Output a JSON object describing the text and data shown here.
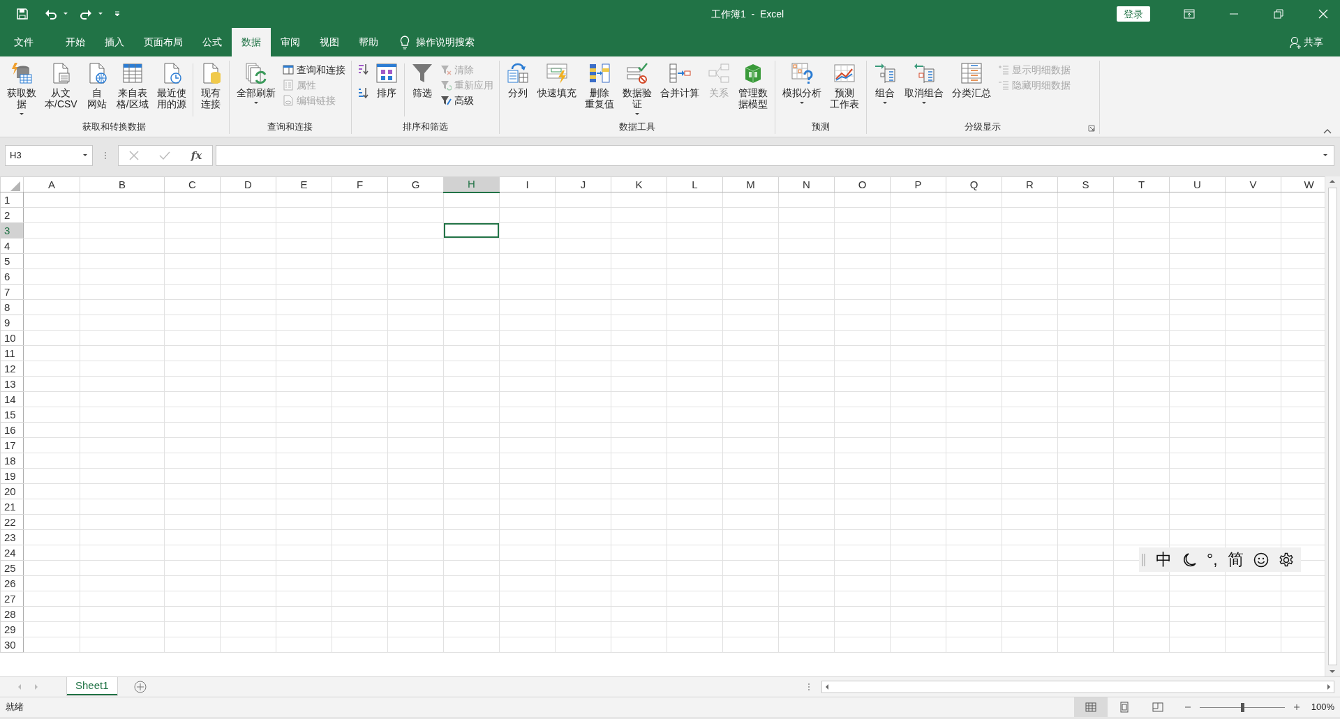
{
  "window": {
    "title": "工作簿1  -  Excel",
    "sign_in": "登录"
  },
  "tabs": [
    {
      "label": "文件",
      "selected": false
    },
    {
      "label": "开始",
      "selected": false
    },
    {
      "label": "插入",
      "selected": false
    },
    {
      "label": "页面布局",
      "selected": false
    },
    {
      "label": "公式",
      "selected": false
    },
    {
      "label": "数据",
      "selected": true
    },
    {
      "label": "审阅",
      "selected": false
    },
    {
      "label": "视图",
      "selected": false
    },
    {
      "label": "帮助",
      "selected": false
    }
  ],
  "tell_me": "操作说明搜索",
  "share": "共享",
  "ribbon": {
    "groups": [
      {
        "label": "获取和转换数据",
        "items": [
          {
            "kind": "large",
            "lines": [
              "获取数",
              "据"
            ],
            "dropdown": true,
            "disabled": false
          },
          {
            "kind": "large",
            "lines": [
              "从文",
              "本/CSV"
            ],
            "disabled": false
          },
          {
            "kind": "large",
            "lines": [
              "自",
              "网站"
            ],
            "disabled": false
          },
          {
            "kind": "large",
            "lines": [
              "来自表",
              "格/区域"
            ],
            "disabled": false
          },
          {
            "kind": "large",
            "lines": [
              "最近使",
              "用的源"
            ],
            "disabled": false
          },
          {
            "kind": "separator"
          },
          {
            "kind": "large",
            "lines": [
              "现有",
              "连接"
            ],
            "disabled": false
          }
        ]
      },
      {
        "label": "查询和连接",
        "items": [
          {
            "kind": "large",
            "lines": [
              "全部刷新"
            ],
            "dropdown": true,
            "disabled": false
          },
          {
            "kind": "stack",
            "items": [
              {
                "label": "查询和连接",
                "disabled": false
              },
              {
                "label": "属性",
                "disabled": true
              },
              {
                "label": "编辑链接",
                "disabled": true
              }
            ]
          }
        ]
      },
      {
        "label": "排序和筛选",
        "items": [
          {
            "kind": "stack",
            "items": [
              {
                "disabled": false
              },
              {
                "disabled": false
              }
            ]
          },
          {
            "kind": "large",
            "lines": [
              "排序"
            ],
            "disabled": false
          },
          {
            "kind": "separator"
          },
          {
            "kind": "large",
            "lines": [
              "筛选"
            ],
            "disabled": false
          },
          {
            "kind": "stack",
            "items": [
              {
                "label": "清除",
                "disabled": true
              },
              {
                "label": "重新应用",
                "disabled": true
              },
              {
                "label": "高级",
                "disabled": false
              }
            ]
          }
        ]
      },
      {
        "label": "数据工具",
        "items": [
          {
            "kind": "large",
            "lines": [
              "分列"
            ],
            "disabled": false
          },
          {
            "kind": "large",
            "lines": [
              "快速填充"
            ],
            "disabled": false
          },
          {
            "kind": "large",
            "lines": [
              "删除",
              "重复值"
            ],
            "disabled": false
          },
          {
            "kind": "large",
            "lines": [
              "数据验",
              "证"
            ],
            "dropdown": true,
            "disabled": false
          },
          {
            "kind": "large",
            "lines": [
              "合并计算"
            ],
            "disabled": false
          },
          {
            "kind": "large",
            "lines": [
              "关系"
            ],
            "disabled": true
          },
          {
            "kind": "large",
            "lines": [
              "管理数",
              "据模型"
            ],
            "disabled": false
          }
        ]
      },
      {
        "label": "预测",
        "items": [
          {
            "kind": "large",
            "lines": [
              "模拟分析"
            ],
            "dropdown": true,
            "disabled": false
          },
          {
            "kind": "large",
            "lines": [
              "预测",
              "工作表"
            ],
            "disabled": false
          }
        ]
      },
      {
        "label": "分级显示",
        "dialog_launcher": true,
        "items": [
          {
            "kind": "large",
            "lines": [
              "组合"
            ],
            "dropdown": true,
            "disabled": false
          },
          {
            "kind": "large",
            "lines": [
              "取消组合"
            ],
            "dropdown": true,
            "disabled": false
          },
          {
            "kind": "large",
            "lines": [
              "分类汇总"
            ],
            "disabled": false
          },
          {
            "kind": "stack",
            "items": [
              {
                "label": "显示明细数据",
                "disabled": true
              },
              {
                "label": "隐藏明细数据",
                "disabled": true
              }
            ]
          }
        ]
      }
    ]
  },
  "formula_bar": {
    "name_box": "H3",
    "function_label": "fx"
  },
  "columns": [
    {
      "label": "A",
      "selected": false
    },
    {
      "label": "B",
      "selected": false
    },
    {
      "label": "C",
      "selected": false
    },
    {
      "label": "D",
      "selected": false
    },
    {
      "label": "E",
      "selected": false
    },
    {
      "label": "F",
      "selected": false
    },
    {
      "label": "G",
      "selected": false
    },
    {
      "label": "H",
      "selected": true
    },
    {
      "label": "I",
      "selected": false
    },
    {
      "label": "J",
      "selected": false
    },
    {
      "label": "K",
      "selected": false
    },
    {
      "label": "L",
      "selected": false
    },
    {
      "label": "M",
      "selected": false
    },
    {
      "label": "N",
      "selected": false
    },
    {
      "label": "O",
      "selected": false
    },
    {
      "label": "P",
      "selected": false
    },
    {
      "label": "Q",
      "selected": false
    },
    {
      "label": "R",
      "selected": false
    },
    {
      "label": "S",
      "selected": false
    },
    {
      "label": "T",
      "selected": false
    },
    {
      "label": "U",
      "selected": false
    },
    {
      "label": "V",
      "selected": false
    },
    {
      "label": "W",
      "selected": false
    }
  ],
  "rows": [
    {
      "label": "1",
      "selected": false
    },
    {
      "label": "2",
      "selected": false
    },
    {
      "label": "3",
      "selected": true
    },
    {
      "label": "4",
      "selected": false
    },
    {
      "label": "5",
      "selected": false
    },
    {
      "label": "6",
      "selected": false
    },
    {
      "label": "7",
      "selected": false
    },
    {
      "label": "8",
      "selected": false
    },
    {
      "label": "9",
      "selected": false
    },
    {
      "label": "10",
      "selected": false
    },
    {
      "label": "11",
      "selected": false
    },
    {
      "label": "12",
      "selected": false
    },
    {
      "label": "13",
      "selected": false
    },
    {
      "label": "14",
      "selected": false
    },
    {
      "label": "15",
      "selected": false
    },
    {
      "label": "16",
      "selected": false
    },
    {
      "label": "17",
      "selected": false
    },
    {
      "label": "18",
      "selected": false
    },
    {
      "label": "19",
      "selected": false
    },
    {
      "label": "20",
      "selected": false
    },
    {
      "label": "21",
      "selected": false
    },
    {
      "label": "22",
      "selected": false
    },
    {
      "label": "23",
      "selected": false
    },
    {
      "label": "24",
      "selected": false
    },
    {
      "label": "25",
      "selected": false
    },
    {
      "label": "26",
      "selected": false
    },
    {
      "label": "27",
      "selected": false
    },
    {
      "label": "28",
      "selected": false
    },
    {
      "label": "29",
      "selected": false
    },
    {
      "label": "30",
      "selected": false
    }
  ],
  "sheets": [
    {
      "label": "Sheet1",
      "selected": true
    }
  ],
  "status_bar": {
    "status": "就绪",
    "views": [
      {
        "selected": true
      },
      {
        "selected": false
      },
      {
        "selected": false
      }
    ],
    "zoom": {
      "level": 0.5,
      "reading": "100%"
    }
  },
  "ime_toolbar": {
    "items": [
      {
        "kind": "text",
        "label": "中"
      },
      {
        "kind": "icon"
      },
      {
        "kind": "text",
        "label": "°,"
      },
      {
        "kind": "text",
        "label": "简"
      },
      {
        "kind": "icon"
      },
      {
        "kind": "icon"
      }
    ]
  }
}
